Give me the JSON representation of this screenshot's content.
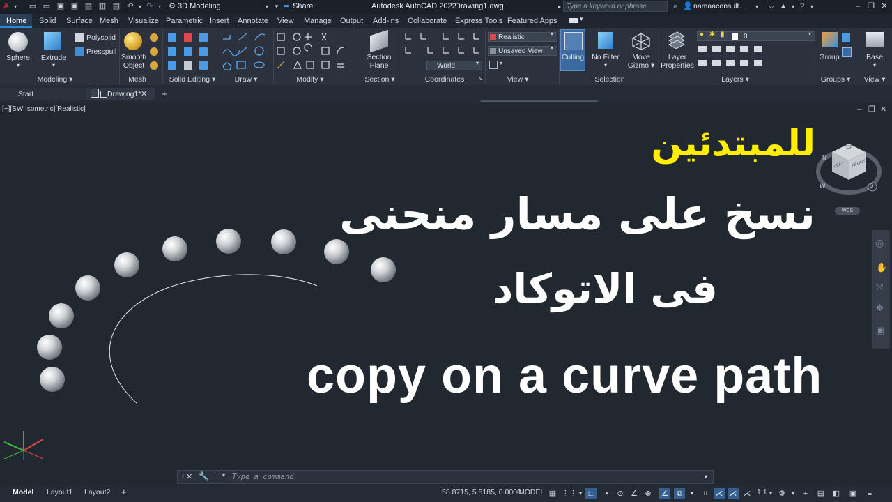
{
  "title_bar": {
    "workspace": "3D Modeling",
    "share": "Share",
    "app_title": "Autodesk AutoCAD 2022",
    "file_name": "Drawing1.dwg",
    "search_placeholder": "Type a keyword or phrase",
    "user": "namaaconsult..."
  },
  "ribbon_tabs": [
    "Home",
    "Solid",
    "Surface",
    "Mesh",
    "Visualize",
    "Parametric",
    "Insert",
    "Annotate",
    "View",
    "Manage",
    "Output",
    "Add-ins",
    "Collaborate",
    "Express Tools",
    "Featured Apps"
  ],
  "ribbon": {
    "modeling": {
      "sphere": "Sphere",
      "extrude": "Extrude",
      "polysolid": "Polysolid",
      "presspull": "Presspull",
      "title": "Modeling"
    },
    "mesh": {
      "smooth_object_1": "Smooth",
      "smooth_object_2": "Object",
      "title": "Mesh"
    },
    "solid_editing": {
      "title": "Solid Editing"
    },
    "draw": {
      "title": "Draw"
    },
    "modify": {
      "title": "Modify"
    },
    "section": {
      "section_plane_1": "Section",
      "section_plane_2": "Plane",
      "title": "Section"
    },
    "coordinates": {
      "ucs": "World",
      "title": "Coordinates"
    },
    "view": {
      "visual_style": "Realistic",
      "named_view": "Unsaved View",
      "title": "View"
    },
    "selection": {
      "culling": "Culling",
      "no_filter": "No Filter",
      "move_gizmo_1": "Move",
      "move_gizmo_2": "Gizmo",
      "title": "Selection"
    },
    "layers": {
      "layer_properties_1": "Layer",
      "layer_properties_2": "Properties",
      "current_layer": "0",
      "title": "Layers"
    },
    "groups": {
      "group": "Group",
      "title": "Groups"
    },
    "view2": {
      "base": "Base",
      "title": "View"
    }
  },
  "file_tabs": {
    "start": "Start",
    "drawing": "Drawing1*"
  },
  "viewport": {
    "label": "[−][SW Isometric][Realistic]",
    "overlay_line1": "للمبتدئين",
    "overlay_line2": "نسخ على مسار منحنى",
    "overlay_line3": "فى الاتوكاد",
    "overlay_english": "copy on a curve path",
    "viewcube": {
      "top": "TOP",
      "left": "LEFT",
      "front": "FRONT",
      "w": "W",
      "s": "S",
      "n": "N",
      "wcs": "WCS"
    }
  },
  "command_line": {
    "placeholder": "Type a command"
  },
  "layout_tabs": [
    "Model",
    "Layout1",
    "Layout2"
  ],
  "status_bar": {
    "coordinates": "58.8715, 5.5185, 0.0000",
    "mode": "MODEL",
    "scale": "1:1"
  },
  "colors": {
    "accent": "#2d8ad6",
    "overlay_yellow": "#ffee00",
    "overlay_white": "#ffffff",
    "background": "#212830"
  }
}
